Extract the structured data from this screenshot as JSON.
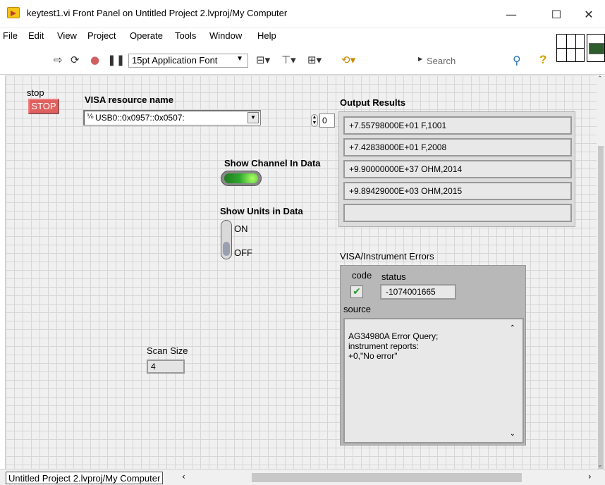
{
  "window": {
    "title": "keytest1.vi Front Panel on Untitled Project 2.lvproj/My Computer",
    "minimize": "—",
    "maximize": "☐",
    "close": "✕"
  },
  "menu": [
    "File",
    "Edit",
    "View",
    "Project",
    "Operate",
    "Tools",
    "Window",
    "Help"
  ],
  "toolbar": {
    "font": "15pt Application Font",
    "search_placeholder": "Search",
    "help": "?"
  },
  "panel": {
    "stop": {
      "label": "stop",
      "button": "STOP"
    },
    "visa": {
      "label": "VISA resource name",
      "io_prefix": "I/O",
      "value": "USB0::0x0957::0x0507:"
    },
    "index_value": "0",
    "output": {
      "label": "Output Results",
      "items": [
        "+7.55798000E+01  F,1001",
        "+7.42838000E+01  F,2008",
        "+9.90000000E+37 OHM,2014",
        "+9.89429000E+03 OHM,2015",
        ""
      ]
    },
    "show_channel": {
      "label": "Show Channel In Data",
      "state": "on"
    },
    "show_units": {
      "label": "Show Units in Data",
      "on": "ON",
      "off": "OFF"
    },
    "scan_size": {
      "label": "Scan Size",
      "value": "4"
    },
    "errors": {
      "label": "VISA/Instrument Errors",
      "code_label": "code",
      "status_label": "status",
      "status_value": "-1074001665",
      "source_label": "source",
      "source_text": "AG34980A Error Query;\ninstrument reports:\n+0,\"No error\""
    }
  },
  "statusbar": {
    "path": "Untitled Project 2.lvproj/My Computer"
  },
  "colors": {
    "stop_red": "#e06060",
    "led_green": "#2ea82e",
    "grid": "#d6d6d6"
  }
}
